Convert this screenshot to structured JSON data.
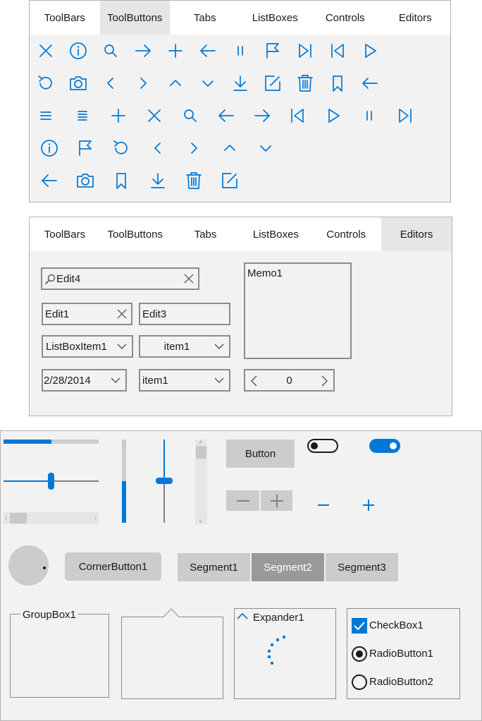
{
  "panel1": {
    "tabs": [
      "ToolBars",
      "ToolButtons",
      "Tabs",
      "ListBoxes",
      "Controls",
      "Editors"
    ],
    "active_tab": "ToolButtons",
    "icon_rows": [
      [
        "close-icon",
        "info-icon",
        "search-icon",
        "arrow-right-icon",
        "plus-icon",
        "arrow-left-icon",
        "pause-icon",
        "flag-icon",
        "skip-forward-icon",
        "skip-back-icon",
        "play-icon"
      ],
      [
        "refresh-icon",
        "camera-icon",
        "chevron-left-icon",
        "chevron-right-icon",
        "chevron-up-icon",
        "chevron-down-icon",
        "download-icon",
        "edit-icon",
        "trash-icon",
        "bookmark-icon",
        "back-icon"
      ],
      [
        "menu-icon",
        "details-icon",
        "plus-icon",
        "close-icon",
        "search-icon",
        "arrow-left-icon",
        "arrow-right-icon",
        "skip-back-icon",
        "play-icon",
        "pause-icon",
        "skip-forward-icon"
      ],
      [
        "info-icon",
        "flag-icon",
        "refresh-icon",
        "chevron-left-icon",
        "chevron-right-icon",
        "chevron-up-icon",
        "chevron-down-icon"
      ],
      [
        "arrow-left-icon",
        "camera-icon",
        "bookmark-icon",
        "download-icon",
        "trash-icon",
        "edit-icon"
      ]
    ]
  },
  "panel2": {
    "tabs": [
      "ToolBars",
      "ToolButtons",
      "Tabs",
      "ListBoxes",
      "Controls",
      "Editors"
    ],
    "active_tab": "Editors",
    "search_edit": "Edit4",
    "edit1": "Edit1",
    "edit3": "Edit3",
    "listbox_combo": "ListBoxItem1",
    "combo_item": "item1",
    "date_edit": "2/28/2014",
    "combo_item2": "item1",
    "spin_value": "0",
    "memo": "Memo1"
  },
  "panel3": {
    "button": "Button",
    "corner_button": "CornerButton1",
    "segments": [
      "Segment1",
      "Segment2",
      "Segment3"
    ],
    "active_segment": "Segment2",
    "groupbox": "GroupBox1",
    "expander": "Expander1",
    "checkbox": "CheckBox1",
    "checkbox_checked": true,
    "radio1": "RadioButton1",
    "radio1_checked": true,
    "radio2": "RadioButton2",
    "radio2_checked": false,
    "progress_fraction": 0.5,
    "switch_off": false,
    "switch_on": true
  },
  "colors": {
    "accent": "#0078d7",
    "panel_bg": "#f2f2f2",
    "border": "#b3b3b3",
    "button_bg": "#cccccc",
    "active_segment_bg": "#999999"
  }
}
